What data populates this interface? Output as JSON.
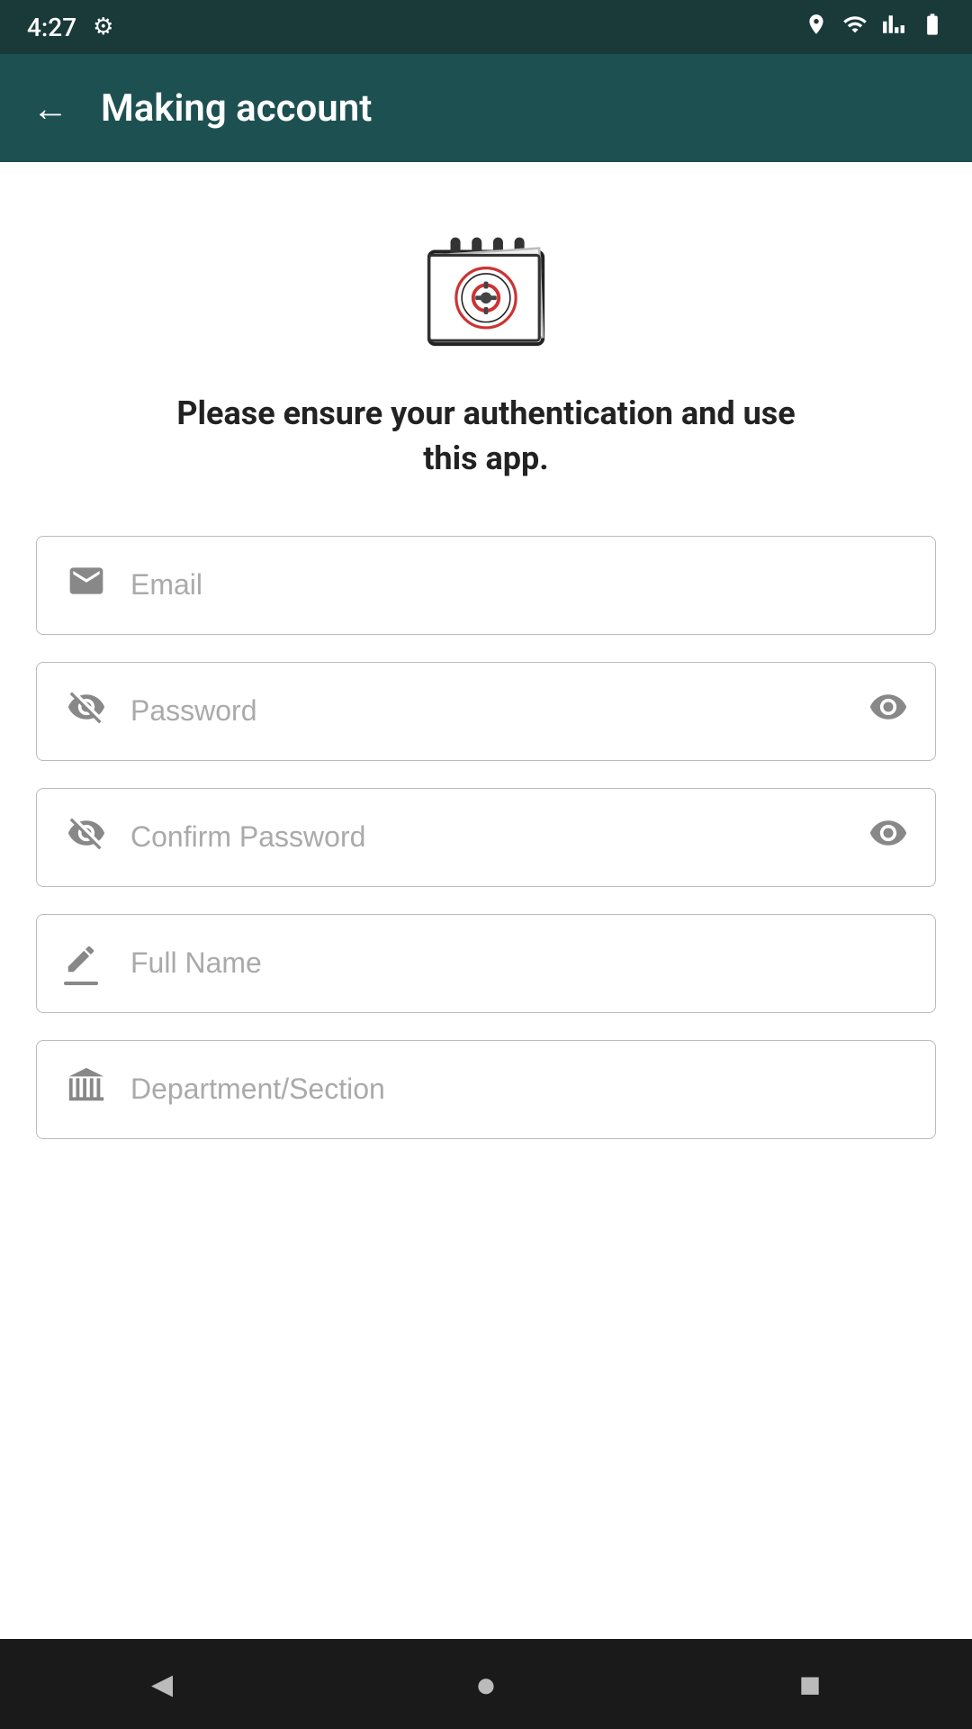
{
  "statusBar": {
    "time": "4:27",
    "gearLabel": "settings"
  },
  "appBar": {
    "backLabel": "←",
    "title": "Making account"
  },
  "main": {
    "subtitle": "Please ensure your authentication and use this app.",
    "fields": [
      {
        "id": "email",
        "placeholder": "Email",
        "type": "email",
        "icon": "email-icon",
        "hasEye": false
      },
      {
        "id": "password",
        "placeholder": "Password",
        "type": "password",
        "icon": "eye-off-icon",
        "hasEye": true
      },
      {
        "id": "confirm-password",
        "placeholder": "Confirm Password",
        "type": "password",
        "icon": "eye-off-icon",
        "hasEye": true
      },
      {
        "id": "full-name",
        "placeholder": "Full Name",
        "type": "text",
        "icon": "pencil-icon",
        "hasEye": false
      },
      {
        "id": "department",
        "placeholder": "Department/Section",
        "type": "text",
        "icon": "building-icon",
        "hasEye": false
      }
    ]
  },
  "navBar": {
    "backLabel": "◄",
    "homeLabel": "●",
    "squareLabel": "■"
  }
}
